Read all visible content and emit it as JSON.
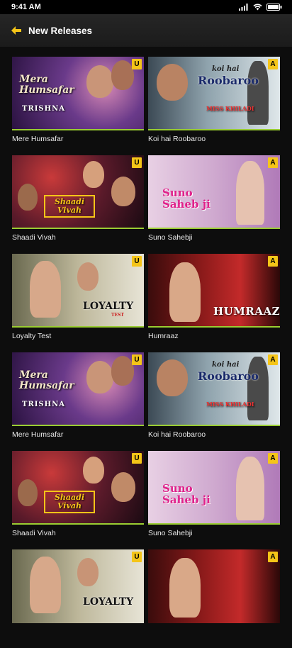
{
  "status": {
    "time": "9:41 AM"
  },
  "header": {
    "title": "New Releases"
  },
  "colors": {
    "accent": "#f5c518",
    "progress": "#9acd32"
  },
  "cards": [
    {
      "title": "Mere Humsafar",
      "rating": "U",
      "poster_text": "Mera Humsafar",
      "poster_sub": "TRISHNA"
    },
    {
      "title": "Koi hai Roobaroo",
      "rating": "A",
      "poster_text": "Roobaroo",
      "poster_pre": "koi hai",
      "poster_sub": "MISS KHILADI"
    },
    {
      "title": "Shaadi Vivah",
      "rating": "U",
      "poster_text": "Shaadi Vivah"
    },
    {
      "title": "Suno Sahebji",
      "rating": "A",
      "poster_text": "Suno Saheb ji"
    },
    {
      "title": "Loyalty Test",
      "rating": "U",
      "poster_text": "LOYALTY",
      "poster_sub": "TEST"
    },
    {
      "title": "Humraaz",
      "rating": "A",
      "poster_text": "HUMRAAZ"
    },
    {
      "title": "Mere Humsafar",
      "rating": "U",
      "poster_text": "Mera Humsafar",
      "poster_sub": "TRISHNA"
    },
    {
      "title": "Koi hai Roobaroo",
      "rating": "A",
      "poster_text": "Roobaroo",
      "poster_pre": "koi hai",
      "poster_sub": "MISS KHILADI"
    },
    {
      "title": "Shaadi Vivah",
      "rating": "U",
      "poster_text": "Shaadi Vivah"
    },
    {
      "title": "Suno Sahebji",
      "rating": "A",
      "poster_text": "Suno Saheb ji"
    },
    {
      "title": "",
      "rating": "U",
      "poster_text": "LOYALTY"
    },
    {
      "title": "",
      "rating": "A",
      "poster_text": ""
    }
  ]
}
